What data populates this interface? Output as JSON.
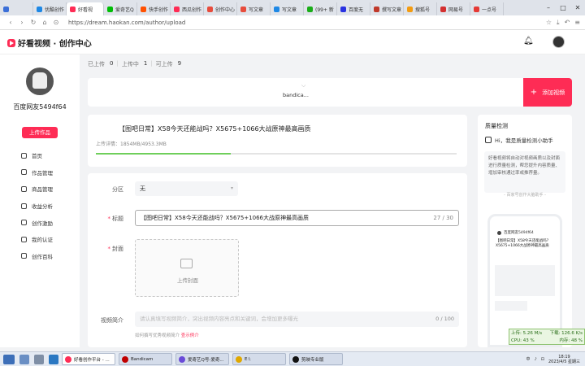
{
  "browser": {
    "tabs": [
      {
        "label": "",
        "color": "#3b6fd8"
      },
      {
        "label": "优酷创作",
        "color": "#1e88e5"
      },
      {
        "label": "好看视",
        "color": "#fe2c55",
        "active": true
      },
      {
        "label": "爱奇艺Q",
        "color": "#00be06"
      },
      {
        "label": "快手创作",
        "color": "#ff5000"
      },
      {
        "label": "西瓜创作",
        "color": "#fe2c55"
      },
      {
        "label": "创作中心",
        "color": "#e74c3c"
      },
      {
        "label": "写文章",
        "color": "#e74c3c"
      },
      {
        "label": "写文章",
        "color": "#1e88e5"
      },
      {
        "label": "(99+ 新",
        "color": "#1aad19"
      },
      {
        "label": "百度无",
        "color": "#2932e1"
      },
      {
        "label": "撰写文章",
        "color": "#c0392b"
      },
      {
        "label": "搜狐号",
        "color": "#f39c12"
      },
      {
        "label": "网易号",
        "color": "#d32f2f"
      },
      {
        "label": "一点号",
        "color": "#e53935"
      }
    ],
    "window_controls": {
      "minimize": "–",
      "maximize": "□",
      "close": "✕"
    },
    "url": "https://dream.haokan.com/author/upload"
  },
  "header": {
    "logo": "好看视频 · 创作中心"
  },
  "sidebar": {
    "username": "百度网友5494f64",
    "upload_button": "上传作品",
    "items": [
      {
        "label": "首页"
      },
      {
        "label": "作品管理"
      },
      {
        "label": "商品管理"
      },
      {
        "label": "收益分析"
      },
      {
        "label": "创作激励"
      },
      {
        "label": "我的认证"
      },
      {
        "label": "创作百科"
      }
    ]
  },
  "stats": {
    "uploaded_label": "已上传",
    "uploaded": "0",
    "uploading_label": "上传中",
    "uploading": "1",
    "pending_label": "可上传",
    "pending": "9"
  },
  "upload_bar": {
    "file_name": "bandica...",
    "add_button": "添加视频"
  },
  "upload_card": {
    "title": "【图吧日常】X58今天还能战吗？X5675+1066大战原神最高画质",
    "progress_text": "上传详情：1854MB/4953.3MB",
    "progress": 0.374
  },
  "form": {
    "category_label": "分区",
    "category_value": "无",
    "title_label": "标题",
    "title_value": "【图吧日常】X58今天还能战吗？X5675+1066大战原神最高画质",
    "title_count": "27 / 30",
    "cover_label": "封面",
    "cover_upload": "上传封面",
    "desc_label": "视频简介",
    "desc_placeholder": "请认真填写视频简介，突出视频内容亮点和关键词，会增加更多曝光",
    "desc_count": "0 / 100",
    "hint_text": "如何撰写优秀视频简介",
    "hint_link": "查示例介"
  },
  "quality": {
    "title": "质量检测",
    "bot": "Hi，我是质量检测小助手",
    "desc": "好看视频将自动对视频画质以及封面进行质量检测，帮您提升内容质量、增加审核通过率或推荐量。",
    "footer": "- 百家号创作大脑助手 -",
    "preview_user": "百度网友5494f64",
    "preview_title": "【图吧日常】X58今天还能战吗？X5675+1066大战原神最高画质"
  },
  "net_monitor": {
    "up": "上传: 5.26 M/s",
    "down": "下载: 126.6 K/s",
    "cpu": "CPU: 43 %",
    "mem": "内存: 48 %"
  },
  "taskbar": {
    "tasks": [
      {
        "label": "好看创作平台 - ...",
        "color": "#fe2c55",
        "active": true
      },
      {
        "label": "Bandicam",
        "color": "#c00000"
      },
      {
        "label": "爱奇艺Q号-爱奇...",
        "color": "#6a4bd8"
      },
      {
        "label": "E:\\",
        "color": "#e0a800"
      },
      {
        "label": "剪映专业版",
        "color": "#111111"
      }
    ],
    "time": "18:19",
    "date": "2023/4/5 星期三"
  }
}
